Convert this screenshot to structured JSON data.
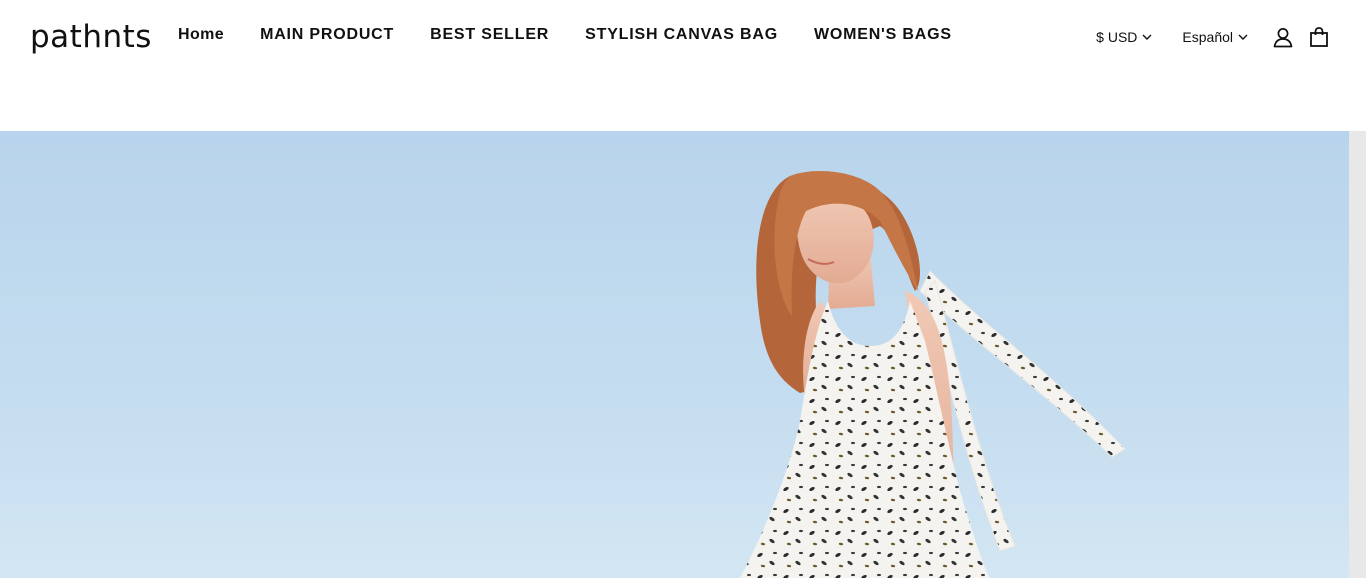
{
  "header": {
    "logo_text": "pathnts",
    "nav": [
      {
        "label": "Home"
      },
      {
        "label": "MAIN PRODUCT"
      },
      {
        "label": "BEST SELLER"
      },
      {
        "label": "STYLISH CANVAS BAG"
      },
      {
        "label": "WOMEN'S BAGS"
      }
    ],
    "currency": "$ USD",
    "language": "Español",
    "account_icon": "user-icon",
    "cart_icon": "shopping-bag-icon"
  },
  "hero": {
    "image": "woman-in-printed-sundress-against-sky",
    "colors": {
      "sky_top": "#b9d5ec",
      "sky_bottom": "#cfe3f2",
      "hair": "#b5673a",
      "dress": "#f3f2ee"
    }
  }
}
